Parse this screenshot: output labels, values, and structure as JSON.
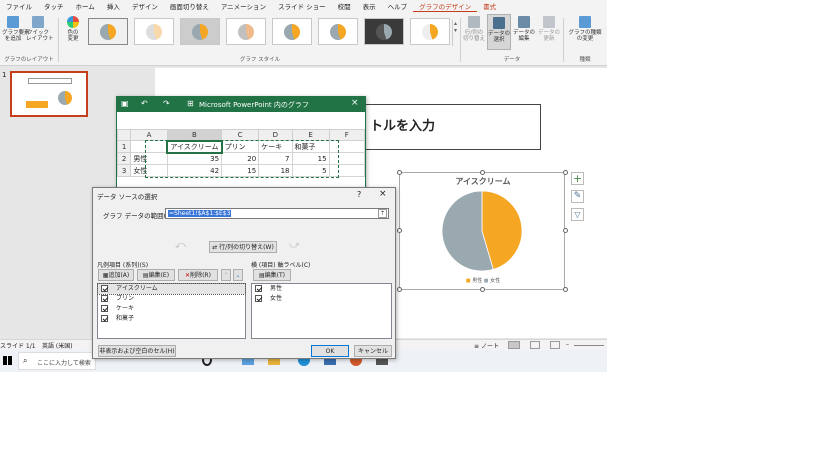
{
  "menu": {
    "items": [
      "ファイル",
      "タッチ",
      "ホーム",
      "挿入",
      "デザイン",
      "画面切り替え",
      "アニメーション",
      "スライド ショー",
      "校閲",
      "表示",
      "ヘルプ",
      "グラフのデザイン",
      "書式"
    ]
  },
  "ribbon": {
    "add_element": "グラフ要素\nを追加",
    "quick_layout": "クイック\nレイアウト",
    "change_color": "色の\n変更",
    "layout_group": "グラフのレイアウト",
    "style_group": "グラフ スタイル",
    "switch_rowcol": "行/列の\n切り替え",
    "select_data": "データの\n選択",
    "edit_data": "データの\n編集",
    "refresh_data": "データの\n更新",
    "data_group": "データ",
    "change_type": "グラフの種類\nの変更",
    "type_group": "種類"
  },
  "slide_panel": {
    "number": "1"
  },
  "slide": {
    "title_placeholder": "トルを入力"
  },
  "excel": {
    "title": "Microsoft PowerPoint 内のグラフ",
    "columns": [
      "",
      "A",
      "B",
      "C",
      "D",
      "E",
      "F"
    ],
    "rows": [
      {
        "num": "1",
        "cells": [
          "",
          "アイスクリーム",
          "プリン",
          "ケーキ",
          "和菓子",
          ""
        ]
      },
      {
        "num": "2",
        "cells": [
          "男性",
          "35",
          "20",
          "7",
          "15",
          ""
        ]
      },
      {
        "num": "3",
        "cells": [
          "女性",
          "42",
          "15",
          "18",
          "5",
          ""
        ]
      }
    ]
  },
  "dialog": {
    "title": "データ ソースの選択",
    "help": "?",
    "close": "×",
    "range_label": "グラフ データの範囲(D):",
    "range_value": "=Sheet1!$A$1:$E$3",
    "switch_button": "行/列の切り替え(W)",
    "legend_label": "凡例項目 (系列)(S)",
    "add": "追加(A)",
    "edit": "編集(E)",
    "delete": "削除(R)",
    "series": [
      "アイスクリーム",
      "プリン",
      "ケーキ",
      "和菓子"
    ],
    "axis_label": "横 (項目) 軸ラベル(C)",
    "axis_edit": "編集(T)",
    "categories": [
      "男性",
      "女性"
    ],
    "hidden_cells": "非表示および空白のセル(H)",
    "ok": "OK",
    "cancel": "キャンセル"
  },
  "chart_data": {
    "type": "pie",
    "title": "アイスクリーム",
    "categories": [
      "男性",
      "女性"
    ],
    "values": [
      35,
      42
    ],
    "colors": [
      "#f5a623",
      "#9aa8b0"
    ],
    "legend": "bottom"
  },
  "status": {
    "slide": "スライド 1/1",
    "lang": "英語 (米国)",
    "notes": "ノート"
  },
  "taskbar": {
    "search_placeholder": "ここに入力して検索"
  }
}
